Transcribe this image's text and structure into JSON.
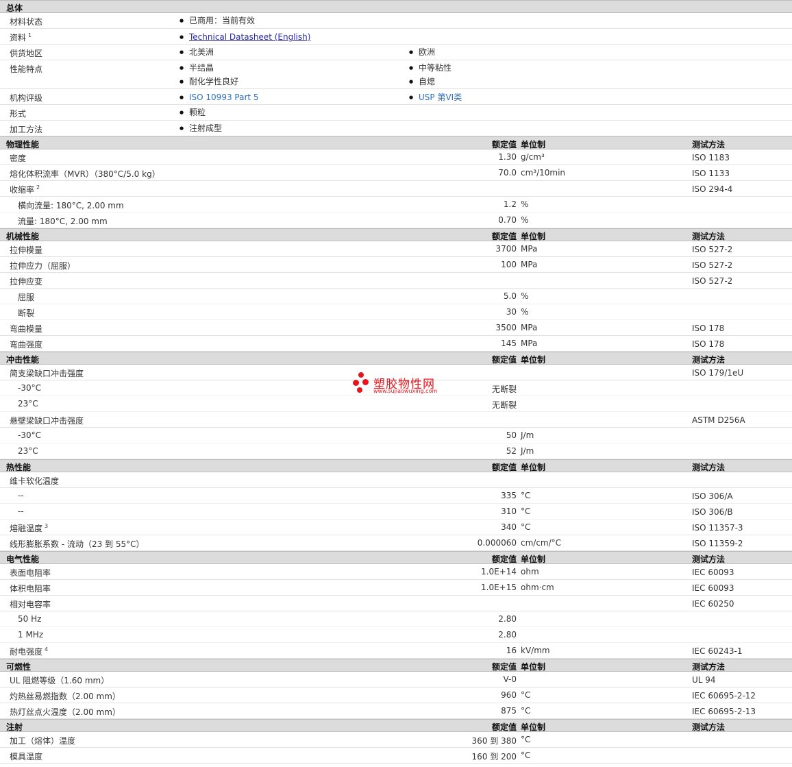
{
  "general": {
    "title": "总体",
    "rows": [
      {
        "label": "材料状态",
        "col1": [
          "已商用：当前有效"
        ],
        "col2": []
      },
      {
        "label": "资料",
        "sup": "1",
        "col1": [
          "Technical Datasheet (English)"
        ],
        "col2": []
      },
      {
        "label": "供货地区",
        "col1": [
          "北美洲"
        ],
        "col2": [
          "欧洲"
        ]
      },
      {
        "label": "性能特点",
        "col1": [
          "半结晶",
          "耐化学性良好"
        ],
        "col2": [
          "中等粘性",
          "自熄"
        ]
      },
      {
        "label": "机构评级",
        "col1": [
          "ISO 10993 Part 5"
        ],
        "col2": [
          "USP 第VI类"
        ]
      },
      {
        "label": "形式",
        "col1": [
          "颗粒"
        ],
        "col2": []
      },
      {
        "label": "加工方法",
        "col1": [
          "注射成型"
        ],
        "col2": []
      }
    ]
  },
  "col_headers": {
    "value": "额定值",
    "unit": "单位制",
    "test": "测试方法"
  },
  "sections": {
    "physical": {
      "title": "物理性能",
      "rows": [
        {
          "label": "密度",
          "value": "1.30",
          "unit": "g/cm³",
          "test": "ISO 1183"
        },
        {
          "label": "熔化体积流率（MVR）（380°C/5.0 kg）",
          "value": "70.0",
          "unit": "cm³/10min",
          "test": "ISO 1133"
        },
        {
          "label": "收缩率",
          "sup": "2",
          "value": "",
          "unit": "",
          "test": "ISO 294-4"
        },
        {
          "label": "横向流量: 180°C, 2.00 mm",
          "value": "1.2",
          "unit": "%",
          "test": ""
        },
        {
          "label": "流量: 180°C, 2.00 mm",
          "value": "0.70",
          "unit": "%",
          "test": ""
        }
      ]
    },
    "mechanical": {
      "title": "机械性能",
      "rows": [
        {
          "label": "拉伸模量",
          "value": "3700",
          "unit": "MPa",
          "test": "ISO 527-2"
        },
        {
          "label": "拉伸应力（屈服）",
          "value": "100",
          "unit": "MPa",
          "test": "ISO 527-2"
        },
        {
          "label": "拉伸应变",
          "value": "",
          "unit": "",
          "test": "ISO 527-2"
        },
        {
          "label": "屈服",
          "value": "5.0",
          "unit": "%",
          "test": ""
        },
        {
          "label": "断裂",
          "value": "30",
          "unit": "%",
          "test": ""
        },
        {
          "label": "弯曲模量",
          "value": "3500",
          "unit": "MPa",
          "test": "ISO 178"
        },
        {
          "label": "弯曲强度",
          "value": "145",
          "unit": "MPa",
          "test": "ISO 178"
        }
      ]
    },
    "impact": {
      "title": "冲击性能",
      "rows": [
        {
          "label": "简支梁缺口冲击强度",
          "value": "",
          "unit": "",
          "test": "ISO 179/1eU"
        },
        {
          "label": "-30°C",
          "value": "无断裂",
          "unit": "",
          "test": ""
        },
        {
          "label": "23°C",
          "value": "无断裂",
          "unit": "",
          "test": ""
        },
        {
          "label": "悬壁梁缺口冲击强度",
          "value": "",
          "unit": "",
          "test": "ASTM D256A"
        },
        {
          "label": "-30°C",
          "value": "50",
          "unit": "J/m",
          "test": ""
        },
        {
          "label": "23°C",
          "value": "52",
          "unit": "J/m",
          "test": ""
        }
      ]
    },
    "thermal": {
      "title": "热性能",
      "rows": [
        {
          "label": "维卡软化温度",
          "value": "",
          "unit": "",
          "test": ""
        },
        {
          "label": "--",
          "value": "335",
          "unit": "°C",
          "test": "ISO 306/A"
        },
        {
          "label": "--",
          "value": "310",
          "unit": "°C",
          "test": "ISO 306/B"
        },
        {
          "label": "熔融温度",
          "sup": "3",
          "value": "340",
          "unit": "°C",
          "test": "ISO 11357-3"
        },
        {
          "label": "线形膨胀系数 - 流动（23 到 55°C）",
          "value": "0.000060",
          "unit": "cm/cm/°C",
          "test": "ISO 11359-2"
        }
      ]
    },
    "electrical": {
      "title": "电气性能",
      "rows": [
        {
          "label": "表面电阻率",
          "value": "1.0E+14",
          "unit": "ohm",
          "test": "IEC 60093"
        },
        {
          "label": "体积电阻率",
          "value": "1.0E+15",
          "unit": "ohm·cm",
          "test": "IEC 60093"
        },
        {
          "label": "相对电容率",
          "value": "",
          "unit": "",
          "test": "IEC 60250"
        },
        {
          "label": "50 Hz",
          "value": "2.80",
          "unit": "",
          "test": ""
        },
        {
          "label": "1 MHz",
          "value": "2.80",
          "unit": "",
          "test": ""
        },
        {
          "label": "耐电强度",
          "sup": "4",
          "value": "16",
          "unit": "kV/mm",
          "test": "IEC 60243-1"
        }
      ]
    },
    "flammability": {
      "title": "可燃性",
      "rows": [
        {
          "label": "UL 阻燃等级（1.60 mm）",
          "value": "V-0",
          "unit": "",
          "test": "UL 94"
        },
        {
          "label": "灼热丝易燃指数（2.00 mm）",
          "value": "960",
          "unit": "°C",
          "test": "IEC 60695-2-12"
        },
        {
          "label": "热灯丝点火温度（2.00 mm）",
          "value": "875",
          "unit": "°C",
          "test": "IEC 60695-2-13"
        }
      ]
    },
    "injection": {
      "title": "注射",
      "rows": [
        {
          "label": "加工（熔体）温度",
          "value": "360 到 380",
          "unit": "°C",
          "test": ""
        },
        {
          "label": "模具温度",
          "value": "160 到 200",
          "unit": "°C",
          "test": ""
        }
      ]
    }
  },
  "watermark": {
    "text": "塑胶物性网",
    "url": "www.sujiaowuxing.com",
    "color": "#e8141b"
  }
}
